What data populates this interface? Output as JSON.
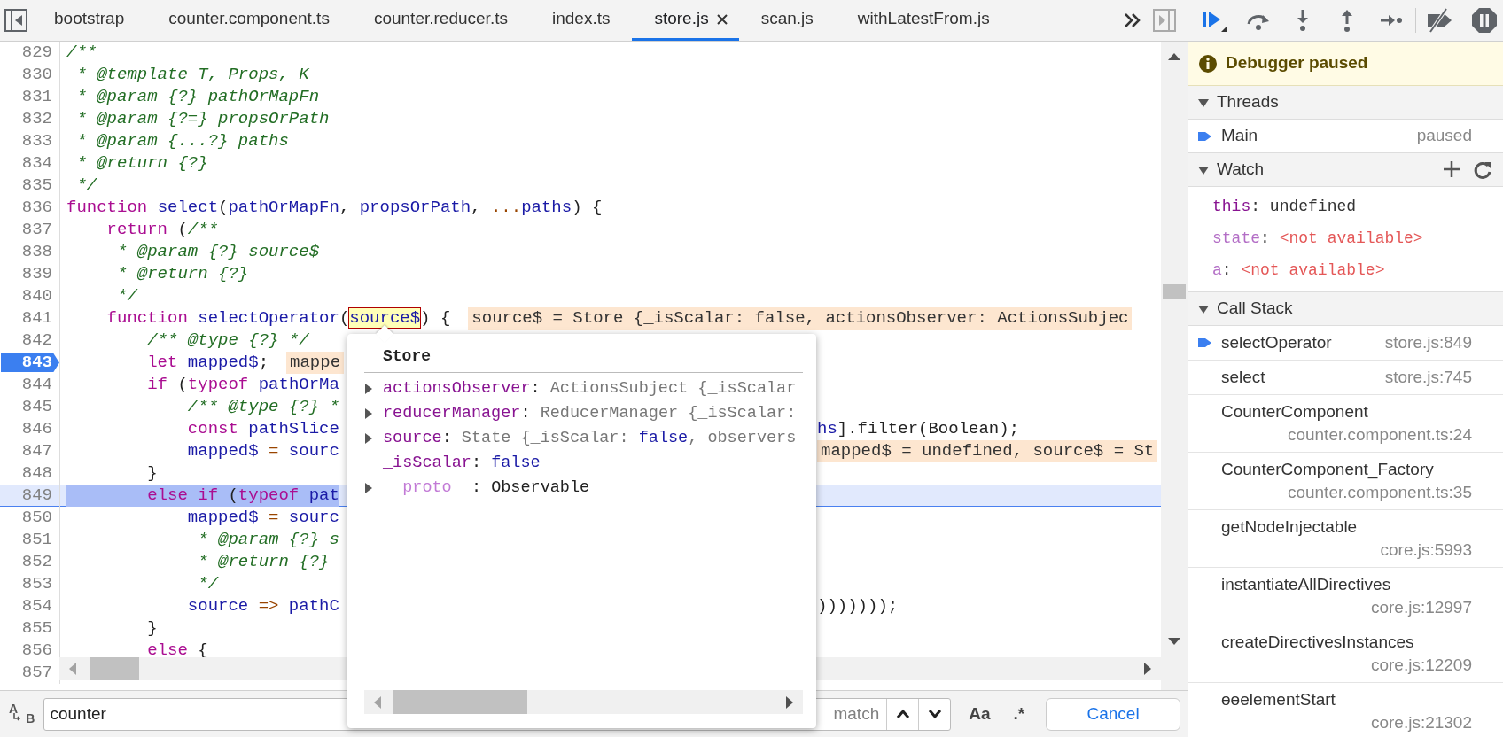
{
  "editor_tabs": [
    {
      "label": "bootstrap",
      "selected": false
    },
    {
      "label": "counter.component.ts",
      "selected": false
    },
    {
      "label": "counter.reducer.ts",
      "selected": false
    },
    {
      "label": "index.ts",
      "selected": false
    },
    {
      "label": "store.js",
      "selected": true
    },
    {
      "label": "scan.js",
      "selected": false
    },
    {
      "label": "withLatestFrom.js",
      "selected": false
    }
  ],
  "code": {
    "lines": [
      {
        "number": "829",
        "breakpoint": false,
        "current": false,
        "tokens": [
          {
            "kind": "comment",
            "text": "/**"
          }
        ]
      },
      {
        "number": "830",
        "breakpoint": false,
        "current": false,
        "tokens": [
          {
            "kind": "comment",
            "text": " * @template T, Props, K"
          }
        ]
      },
      {
        "number": "831",
        "breakpoint": false,
        "current": false,
        "tokens": [
          {
            "kind": "comment",
            "text": " * @param {?} pathOrMapFn"
          }
        ]
      },
      {
        "number": "832",
        "breakpoint": false,
        "current": false,
        "tokens": [
          {
            "kind": "comment",
            "text": " * @param {?=} propsOrPath"
          }
        ]
      },
      {
        "number": "833",
        "breakpoint": false,
        "current": false,
        "tokens": [
          {
            "kind": "comment",
            "text": " * @param {...?} paths"
          }
        ]
      },
      {
        "number": "834",
        "breakpoint": false,
        "current": false,
        "tokens": [
          {
            "kind": "comment",
            "text": " * @return {?}"
          }
        ]
      },
      {
        "number": "835",
        "breakpoint": false,
        "current": false,
        "tokens": [
          {
            "kind": "comment",
            "text": " */"
          }
        ]
      },
      {
        "number": "836",
        "breakpoint": false,
        "current": false,
        "tokens": [
          {
            "kind": "keyword",
            "text": "function "
          },
          {
            "kind": "name",
            "text": "select"
          },
          {
            "kind": "plain",
            "text": "("
          },
          {
            "kind": "name",
            "text": "pathOrMapFn"
          },
          {
            "kind": "plain",
            "text": ", "
          },
          {
            "kind": "name",
            "text": "propsOrPath"
          },
          {
            "kind": "plain",
            "text": ", "
          },
          {
            "kind": "operator",
            "text": "..."
          },
          {
            "kind": "name",
            "text": "paths"
          },
          {
            "kind": "plain",
            "text": ") {"
          }
        ]
      },
      {
        "number": "837",
        "breakpoint": false,
        "current": false,
        "tokens": [
          {
            "kind": "keyword",
            "text": "    return"
          },
          {
            "kind": "plain",
            "text": " ("
          },
          {
            "kind": "comment",
            "text": "/**"
          }
        ]
      },
      {
        "number": "838",
        "breakpoint": false,
        "current": false,
        "tokens": [
          {
            "kind": "comment",
            "text": "     * @param {?} source$"
          }
        ]
      },
      {
        "number": "839",
        "breakpoint": false,
        "current": false,
        "tokens": [
          {
            "kind": "comment",
            "text": "     * @return {?}"
          }
        ]
      },
      {
        "number": "840",
        "breakpoint": false,
        "current": false,
        "tokens": [
          {
            "kind": "comment",
            "text": "     */"
          }
        ]
      },
      {
        "number": "841",
        "breakpoint": false,
        "current": false,
        "tokens": [
          {
            "kind": "keyword",
            "text": "    function "
          },
          {
            "kind": "name",
            "text": "selectOperator"
          },
          {
            "kind": "plain",
            "text": "("
          },
          {
            "kind": "hovered",
            "text": "source$"
          },
          {
            "kind": "plain",
            "text": ") {"
          }
        ],
        "inline_value": "source$ = Store {_isScalar: false, actionsObserver: ActionsSubjec"
      },
      {
        "number": "842",
        "breakpoint": false,
        "current": false,
        "tokens": [
          {
            "kind": "comment",
            "text": "        /** @type {?} */"
          }
        ]
      },
      {
        "number": "843",
        "breakpoint": true,
        "current": false,
        "tokens": [
          {
            "kind": "keyword",
            "text": "        let "
          },
          {
            "kind": "name",
            "text": "mapped$"
          },
          {
            "kind": "plain",
            "text": ";"
          }
        ],
        "inline_value": "mappe"
      },
      {
        "number": "844",
        "breakpoint": false,
        "current": false,
        "tokens": [
          {
            "kind": "keyword",
            "text": "        if"
          },
          {
            "kind": "plain",
            "text": " ("
          },
          {
            "kind": "keyword",
            "text": "typeof "
          },
          {
            "kind": "name",
            "text": "pathOrMa"
          }
        ]
      },
      {
        "number": "845",
        "breakpoint": false,
        "current": false,
        "tokens": [
          {
            "kind": "comment",
            "text": "            /** @type {?} *"
          }
        ]
      },
      {
        "number": "846",
        "breakpoint": false,
        "current": false,
        "tokens": [
          {
            "kind": "keyword",
            "text": "            const "
          },
          {
            "kind": "name",
            "text": "pathSlice"
          }
        ],
        "after_popup": {
          "tokens": [
            {
              "kind": "name",
              "text": "hs"
            },
            {
              "kind": "plain",
              "text": "].filter(Boolean);"
            }
          ]
        }
      },
      {
        "number": "847",
        "breakpoint": false,
        "current": false,
        "tokens": [
          {
            "kind": "name",
            "text": "            mapped$"
          },
          {
            "kind": "operator",
            "text": " = "
          },
          {
            "kind": "name",
            "text": "sourc"
          }
        ],
        "after_popup": {
          "inline_value": "mapped$ = undefined, source$ = St"
        }
      },
      {
        "number": "848",
        "breakpoint": false,
        "current": false,
        "tokens": [
          {
            "kind": "plain",
            "text": "        }"
          }
        ]
      },
      {
        "number": "849",
        "breakpoint": false,
        "current": true,
        "tokens": [
          {
            "kind": "keyword",
            "text": "        else if"
          },
          {
            "kind": "plain",
            "text": " ("
          },
          {
            "kind": "keyword",
            "text": "typeof "
          },
          {
            "kind": "name",
            "text": "pat"
          }
        ]
      },
      {
        "number": "850",
        "breakpoint": false,
        "current": false,
        "tokens": [
          {
            "kind": "name",
            "text": "            mapped$"
          },
          {
            "kind": "operator",
            "text": " = "
          },
          {
            "kind": "name",
            "text": "sourc"
          }
        ]
      },
      {
        "number": "851",
        "breakpoint": false,
        "current": false,
        "tokens": [
          {
            "kind": "comment",
            "text": "             * @param {?} s"
          }
        ]
      },
      {
        "number": "852",
        "breakpoint": false,
        "current": false,
        "tokens": [
          {
            "kind": "comment",
            "text": "             * @return {?}"
          }
        ]
      },
      {
        "number": "853",
        "breakpoint": false,
        "current": false,
        "tokens": [
          {
            "kind": "comment",
            "text": "             */"
          }
        ]
      },
      {
        "number": "854",
        "breakpoint": false,
        "current": false,
        "tokens": [
          {
            "kind": "name",
            "text": "            source"
          },
          {
            "kind": "operator",
            "text": " => "
          },
          {
            "kind": "name",
            "text": "pathC"
          }
        ],
        "after_popup": {
          "tokens": [
            {
              "kind": "plain",
              "text": ")))))));"
            }
          ]
        }
      },
      {
        "number": "855",
        "breakpoint": false,
        "current": false,
        "tokens": [
          {
            "kind": "plain",
            "text": "        }"
          }
        ]
      },
      {
        "number": "856",
        "breakpoint": false,
        "current": false,
        "tokens": [
          {
            "kind": "keyword",
            "text": "        else"
          },
          {
            "kind": "plain",
            "text": " {"
          }
        ]
      },
      {
        "number": "857",
        "breakpoint": false,
        "current": false
      }
    ]
  },
  "popover": {
    "title": "Store",
    "items": [
      {
        "key": "actionsObserver",
        "separator": ":",
        "internal": false,
        "expandable": true,
        "value": [
          {
            "kind": "preview",
            "text": "ActionsSubject {_isScalar"
          }
        ]
      },
      {
        "key": "reducerManager",
        "separator": ":",
        "internal": false,
        "expandable": true,
        "value": [
          {
            "kind": "preview",
            "text": "ReducerManager {_isScalar:"
          }
        ]
      },
      {
        "key": "source",
        "separator": ":",
        "internal": false,
        "expandable": true,
        "value": [
          {
            "kind": "preview",
            "text": "State {_isScalar: "
          },
          {
            "kind": "literal",
            "text": "false"
          },
          {
            "kind": "preview",
            "text": ", observers"
          }
        ]
      },
      {
        "key": "_isScalar",
        "separator": ":",
        "internal": false,
        "expandable": false,
        "value": [
          {
            "kind": "literal",
            "text": "false"
          }
        ]
      },
      {
        "key": "__proto__",
        "separator": ":",
        "internal": true,
        "expandable": true,
        "value": [
          {
            "kind": "plain",
            "text": "Observable"
          }
        ]
      }
    ]
  },
  "search": {
    "replace_toggle": {
      "upper": "A",
      "lower": "B"
    },
    "value": "counter",
    "status": "match",
    "case_label": "Aa",
    "regex_label": ".*",
    "cancel": "Cancel"
  },
  "debugger": {
    "banner": "Debugger paused",
    "sections": [
      {
        "kind": "threads",
        "title": "Threads",
        "expanded": true,
        "threads": [
          {
            "name": "Main",
            "status": "paused",
            "selected": true
          }
        ]
      },
      {
        "kind": "watch",
        "title": "Watch",
        "expanded": true,
        "watches": [
          {
            "name": "this",
            "separator": ":",
            "value": "undefined",
            "available": true
          },
          {
            "name": "state",
            "separator": ":",
            "value": "<not available>",
            "available": false
          },
          {
            "name": "a",
            "separator": ":",
            "value": "<not available>",
            "available": false
          }
        ]
      },
      {
        "kind": "callstack",
        "title": "Call Stack",
        "expanded": true,
        "frames": [
          {
            "function": "selectOperator",
            "location": "store.js:849",
            "selected": true
          },
          {
            "function": "select",
            "location": "store.js:745",
            "selected": false
          },
          {
            "function": "CounterComponent",
            "location": "counter.component.ts:24",
            "selected": false
          },
          {
            "function": "CounterComponent_Factory",
            "location": "counter.component.ts:35",
            "selected": false
          },
          {
            "function": "getNodeInjectable",
            "location": "core.js:5993",
            "selected": false
          },
          {
            "function": "instantiateAllDirectives",
            "location": "core.js:12997",
            "selected": false
          },
          {
            "function": "createDirectivesInstances",
            "location": "core.js:12209",
            "selected": false
          },
          {
            "function": "ɵɵelementStart",
            "location": "core.js:21302",
            "selected": false
          }
        ]
      }
    ]
  }
}
